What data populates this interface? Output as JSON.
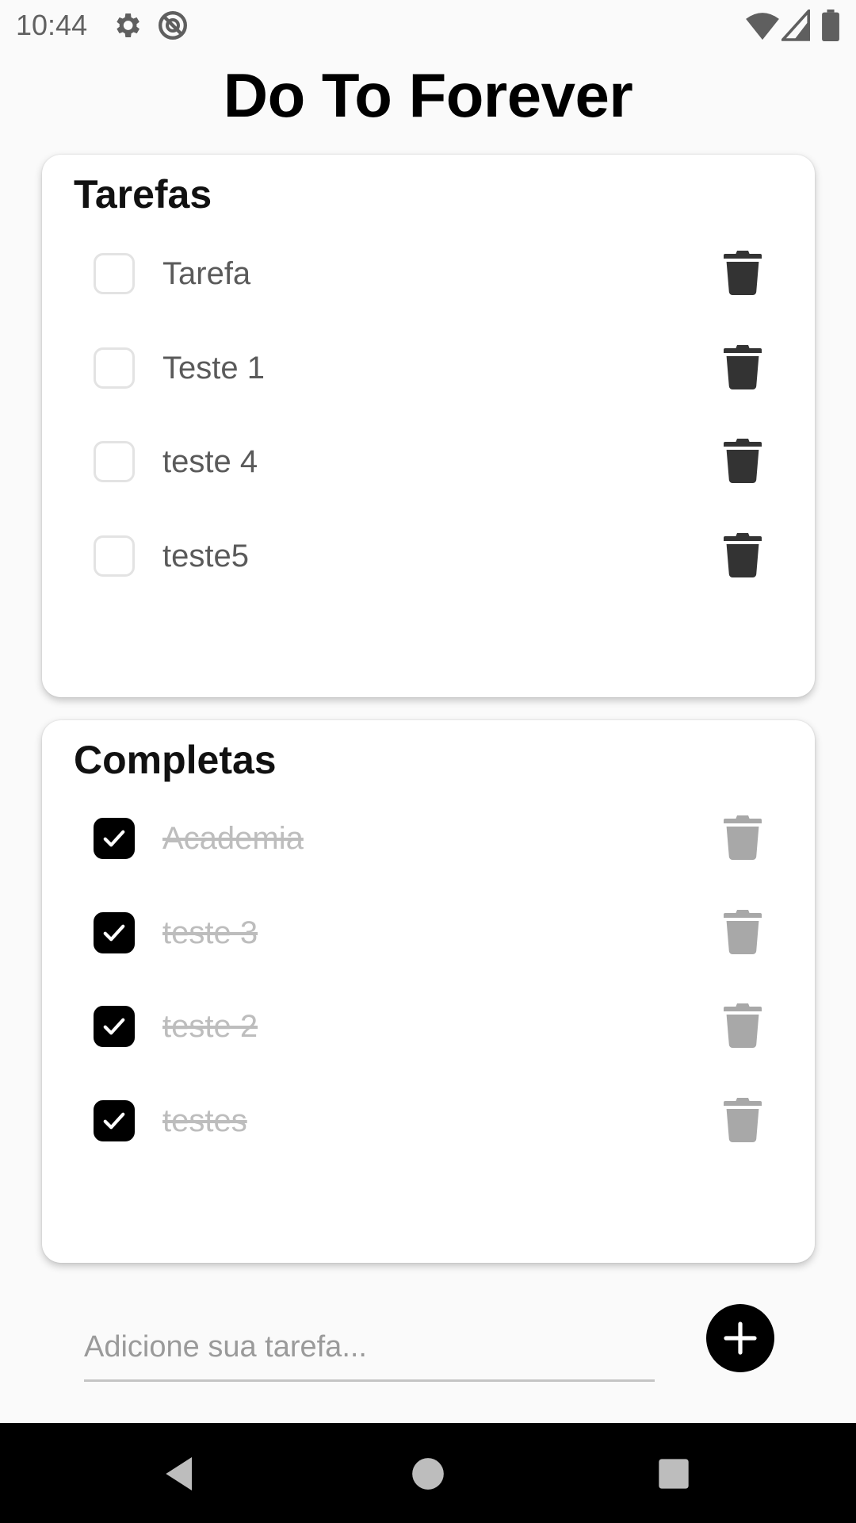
{
  "status_bar": {
    "time": "10:44",
    "icons": [
      "settings-gear-icon",
      "do-not-disturb-icon",
      "wifi-icon",
      "cell-signal-icon",
      "battery-icon"
    ]
  },
  "app": {
    "title": "Do To Forever"
  },
  "pending": {
    "title": "Tarefas",
    "items": [
      {
        "label": "Tarefa",
        "checked": false
      },
      {
        "label": "Teste 1",
        "checked": false
      },
      {
        "label": "teste 4",
        "checked": false
      },
      {
        "label": "teste5",
        "checked": false
      }
    ]
  },
  "completed": {
    "title": "Completas",
    "items": [
      {
        "label": "Academia",
        "checked": true
      },
      {
        "label": "teste 3",
        "checked": true
      },
      {
        "label": "teste 2",
        "checked": true
      },
      {
        "label": "testes",
        "checked": true
      }
    ]
  },
  "composer": {
    "placeholder": "Adicione sua tarefa...",
    "value": ""
  },
  "colors": {
    "accent": "#000000",
    "background": "#fafafa",
    "card": "#ffffff",
    "pending_text": "#5a5a5a",
    "done_text": "#bdbdbd",
    "trash_active": "#333333",
    "trash_disabled": "#a8a8a8"
  },
  "nav_bar": {
    "icons": [
      "back-icon",
      "home-icon",
      "recents-icon"
    ]
  }
}
